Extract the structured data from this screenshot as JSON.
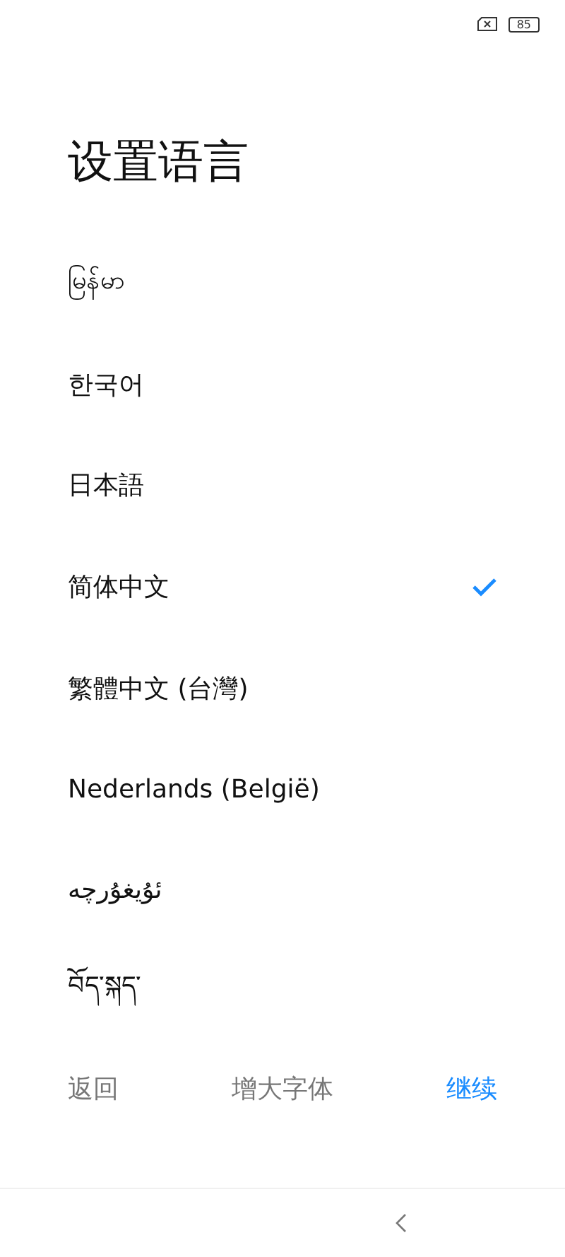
{
  "status_bar": {
    "battery": "85"
  },
  "title": "设置语言",
  "languages": [
    {
      "label": "မြန်မာ",
      "selected": false
    },
    {
      "label": "한국어",
      "selected": false
    },
    {
      "label": "日本語",
      "selected": false
    },
    {
      "label": "简体中文",
      "selected": true
    },
    {
      "label": "繁體中文 (台灣)",
      "selected": false
    },
    {
      "label": "Nederlands (België)",
      "selected": false
    },
    {
      "label": "ئۇيغۇرچە",
      "selected": false
    },
    {
      "label": "བོད་སྐད་",
      "selected": false
    }
  ],
  "actions": [
    {
      "label": "返回",
      "kind": "secondary"
    },
    {
      "label": "增大字体",
      "kind": "secondary"
    },
    {
      "label": "继续",
      "kind": "primary"
    }
  ]
}
